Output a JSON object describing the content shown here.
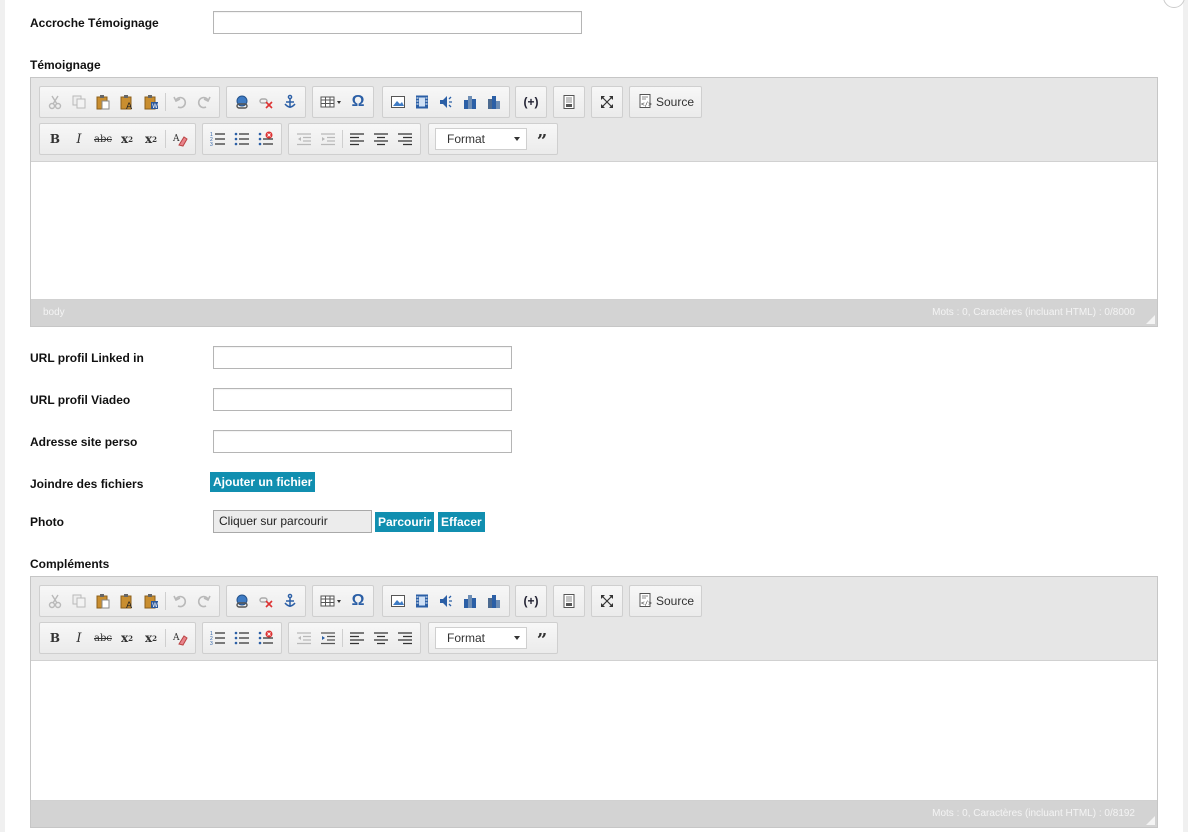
{
  "fields": {
    "accroche_label": "Accroche Témoignage",
    "temoignage_label": "Témoignage",
    "linkedin_label": "URL profil Linked in",
    "viadeo_label": "URL profil Viadeo",
    "site_label": "Adresse site perso",
    "joindre_label": "Joindre des fichiers",
    "photo_label": "Photo",
    "complements_label": "Compléments"
  },
  "buttons": {
    "ajouter_fichier": "Ajouter un fichier",
    "parcourir": "Parcourir",
    "effacer": "Effacer"
  },
  "photo": {
    "value": "Cliquer sur parcourir"
  },
  "editor_toolbar": {
    "source_label": "Source",
    "format_label": "Format",
    "icons_row1": [
      "cut-icon",
      "copy-icon",
      "paste-icon",
      "paste-text-icon",
      "paste-word-icon",
      "undo-icon",
      "redo-icon",
      "link-icon",
      "unlink-icon",
      "anchor-icon",
      "table-icon",
      "special-char-icon",
      "image-icon",
      "video-icon",
      "audio-icon",
      "flash-icon",
      "flash-icon",
      "plugin-icon",
      "template-icon",
      "maximize-icon",
      "source-icon"
    ],
    "icons_row2": [
      "bold-icon",
      "italic-icon",
      "strike-icon",
      "subscript-icon",
      "superscript-icon",
      "remove-format-icon",
      "numbered-list-icon",
      "bullet-list-icon",
      "remove-list-icon",
      "outdent-icon",
      "indent-icon",
      "align-left-icon",
      "align-center-icon",
      "align-right-icon",
      "blockquote-icon"
    ]
  },
  "editor1": {
    "path": "body",
    "counter": "Mots : 0, Caractères (incluant HTML) : 0/8000"
  },
  "editor2": {
    "path": "",
    "counter": "Mots : 0, Caractères (incluant HTML) : 0/8192"
  },
  "colors": {
    "accent": "#118fb0",
    "toolbar_bg": "#e6e6e6",
    "status_bg": "#d3d3d3"
  }
}
